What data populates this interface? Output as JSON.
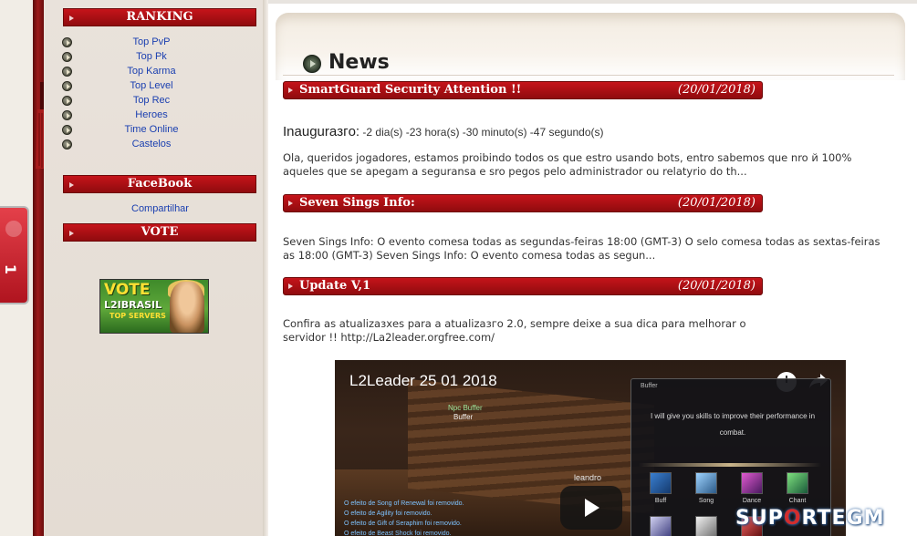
{
  "sidebar": {
    "ranking_header": "RANKING",
    "ranking_items": [
      "Top PvP",
      "Top Pk",
      "Top Karma",
      "Top Level",
      "Top Rec",
      "Heroes",
      "Time Online",
      "Castelos"
    ],
    "facebook_header": "FaceBook",
    "facebook_link": "Compartilhar",
    "vote_header": "VOTE",
    "vote_banner": {
      "word": "VOTE",
      "brand": "L2IBRASIL",
      "sub": "TOP SERVERS"
    }
  },
  "side_tab": {
    "number": "1"
  },
  "main": {
    "page_title": "News",
    "posts": [
      {
        "title": "SmartGuard Security Attention !!",
        "date": "(20/01/2018)",
        "countdown_label": "Inauguraзгo:",
        "countdown_value": "-2 dia(s) -23 hora(s) -30 minuto(s) -47 segundo(s)",
        "body": "Ola, queridos jogadores, estamos proibindo todos os que estro usando bots, entro sabemos que nro й 100% aqueles que se apegam a seguransa e sro pegos pelo administrador ou relatyrio do th..."
      },
      {
        "title": "Seven Sings Info:",
        "date": "(20/01/2018)",
        "body": "Seven Sings Info: O evento comesa todas as segundas-feiras 18:00 (GMT-3) O selo comesa todas as sextas-feiras as 18:00 (GMT-3) Seven Sings Info: O evento comesa todas as segun..."
      },
      {
        "title": "Update V,1",
        "date": "(20/01/2018)",
        "body": "Confira as atualizaзхes para a atualizaзго 2.0, sempre deixe a sua dica para melhorar o servidor !! http://La2leader.orgfree.com/"
      }
    ],
    "video": {
      "title": "L2Leader 25 01 2018",
      "npc_tag": "Npc Buffer",
      "npc_name": "Buffer",
      "player_name": "leandro",
      "panel_title": "Buffer",
      "panel_text": "I will give you skills to improve their performance in combat.",
      "skills": [
        "Buff",
        "Song",
        "Dance",
        "Chant"
      ],
      "chat_lines": [
        "O efeito de Song of Renewal foi removido.",
        "O efeito de Agility foi removido.",
        "O efeito de Gift of Seraphim foi removido.",
        "O efeito de Beast Shock foi removido."
      ]
    }
  },
  "watermark": {
    "prefix": "SUP",
    "o": "O",
    "suffix": "RTEGM"
  },
  "colors": {
    "header_red": "#b01217",
    "link_blue": "#1a3fb0",
    "sidebar_bg": "#e6dfd7",
    "pillar": "#8a1414"
  }
}
